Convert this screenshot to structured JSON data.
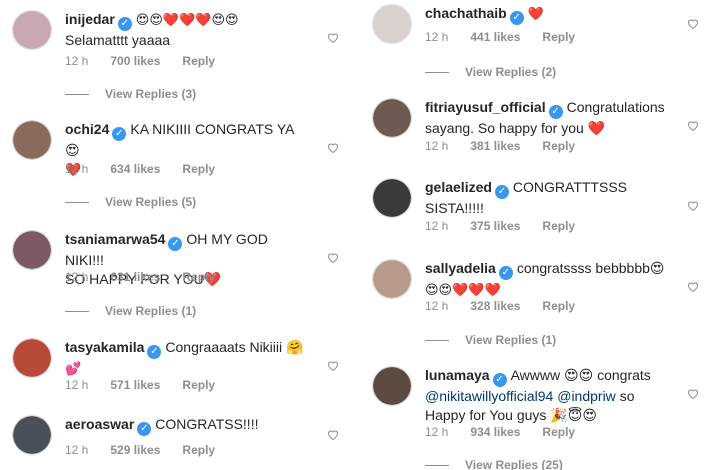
{
  "left": [
    {
      "username": "inijedar",
      "text": "😍😍❤️❤️❤️😍😍",
      "text2": "Selamatttt yaaaa",
      "time": "12 h",
      "likes": "700 likes",
      "reply": "Reply",
      "view_replies": "View Replies (3)",
      "avatar_color": "#c9a8b4"
    },
    {
      "username": "ochi24",
      "text": "KA NIKIIII CONGRATS YA 😍",
      "text2": "❤️",
      "time": "12 h",
      "likes": "634 likes",
      "reply": "Reply",
      "view_replies": "View Replies (5)",
      "avatar_color": "#8a6a5a"
    },
    {
      "username": "tsaniamarwa54",
      "text": "OH MY GOD NIKI!!!",
      "text2": "SO HAPPY FOR YOU❤️",
      "time": "12 h",
      "likes": "631 likes",
      "reply": "Reply",
      "view_replies": "View Replies (1)",
      "avatar_color": "#7d5a63"
    },
    {
      "username": "tasyakamila",
      "text": "Congraaaats Nikiiii 🤗",
      "text2": "💕",
      "time": "12 h",
      "likes": "571 likes",
      "reply": "Reply",
      "avatar_color": "#b84a3a"
    },
    {
      "username": "aeroaswar",
      "text": "CONGRATSS!!!!",
      "text2": "",
      "time": "12 h",
      "likes": "529 likes",
      "reply": "Reply",
      "avatar_color": "#4a5058"
    }
  ],
  "right": [
    {
      "username": "chachathaib",
      "text": "❤️",
      "text2": "",
      "time": "12 h",
      "likes": "441 likes",
      "reply": "Reply",
      "view_replies": "View Replies (2)",
      "avatar_color": "#d8d0cc"
    },
    {
      "username": "fitriayusuf_official",
      "text": "Congratulations",
      "text2": "sayang. So happy for you ❤️",
      "time": "12 h",
      "likes": "381 likes",
      "reply": "Reply",
      "avatar_color": "#6e5a52"
    },
    {
      "username": "gelaelized",
      "text": "CONGRATTTSSS",
      "text2": "SISTA!!!!!",
      "time": "12 h",
      "likes": "375 likes",
      "reply": "Reply",
      "avatar_color": "#3a3a3a"
    },
    {
      "username": "sallyadelia",
      "text": "congratssss bebbbbb😍",
      "text2": "😍😍❤️❤️❤️",
      "time": "12 h",
      "likes": "328 likes",
      "reply": "Reply",
      "view_replies": "View Replies (1)",
      "avatar_color": "#b8998a"
    },
    {
      "username": "lunamaya",
      "text": "Awwww 😍😍 congrats",
      "mention": "@nikitawillyofficial94 @indpriw",
      "text3": "so",
      "text4": "Happy for You guys 🎉😇😍",
      "time": "12 h",
      "likes": "934 likes",
      "reply": "Reply",
      "view_replies": "View Replies (25)",
      "avatar_color": "#5a4a40"
    }
  ],
  "colors": {
    "accent": "#3897f0",
    "muted": "#8e8e8e",
    "text": "#262626"
  },
  "icons": {
    "verified": "verified-badge-icon",
    "like": "heart-outline-icon"
  }
}
